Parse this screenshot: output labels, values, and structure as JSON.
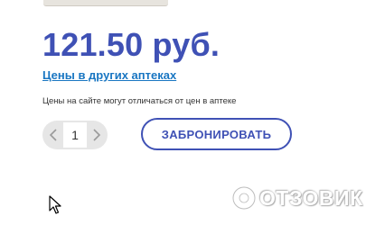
{
  "product": {
    "price": "121.50 руб.",
    "other_pharmacies_link": "Цены в других аптеках",
    "price_note": "Цены на сайте могут отличаться от цен в аптеке"
  },
  "quantity": {
    "value": "1",
    "decrement_icon": "chevron-left-icon",
    "increment_icon": "chevron-right-icon"
  },
  "actions": {
    "reserve_label": "ЗАБРОНИРОВАТЬ"
  },
  "watermark": {
    "text": "ОТЗОВИК"
  },
  "colors": {
    "price": "#3f51b5",
    "link": "#1976c2",
    "button_border": "#3f51b5",
    "stepper_bg": "#e6e6e6"
  }
}
